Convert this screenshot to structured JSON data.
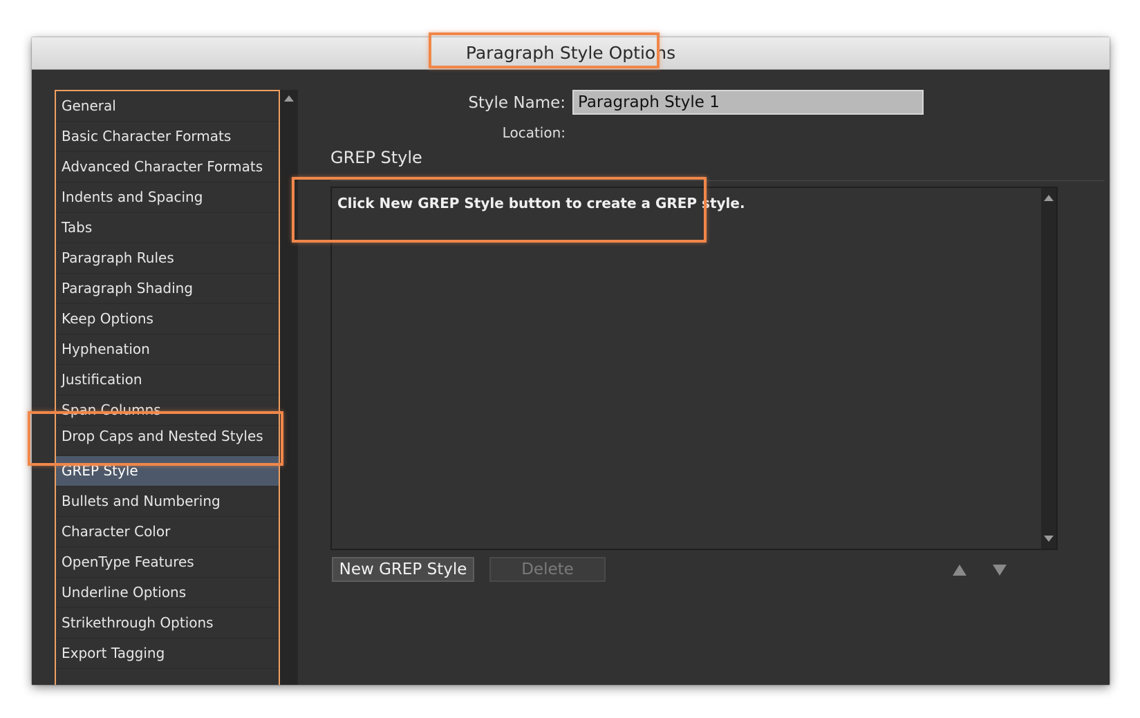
{
  "window": {
    "title": "Paragraph Style Options"
  },
  "sidebar": {
    "items": [
      {
        "label": "General"
      },
      {
        "label": "Basic Character Formats"
      },
      {
        "label": "Advanced Character Formats"
      },
      {
        "label": "Indents and Spacing"
      },
      {
        "label": "Tabs"
      },
      {
        "label": "Paragraph Rules"
      },
      {
        "label": "Paragraph Shading"
      },
      {
        "label": "Keep Options"
      },
      {
        "label": "Hyphenation"
      },
      {
        "label": "Justification"
      },
      {
        "label": "Span Columns"
      },
      {
        "label": "Drop Caps and Nested Styles"
      },
      {
        "label": "GREP Style"
      },
      {
        "label": "Bullets and Numbering"
      },
      {
        "label": "Character Color"
      },
      {
        "label": "OpenType Features"
      },
      {
        "label": "Underline Options"
      },
      {
        "label": "Strikethrough Options"
      },
      {
        "label": "Export Tagging"
      }
    ],
    "selected": "GREP Style"
  },
  "form": {
    "style_name_label": "Style Name:",
    "style_name_value": "Paragraph Style 1",
    "location_label": "Location:"
  },
  "section": {
    "heading": "GREP Style",
    "hint": "Click New GREP Style button to create a GREP style."
  },
  "buttons": {
    "new_grep": "New GREP Style",
    "delete": "Delete"
  },
  "icons": {
    "move_up": "triangle-up-icon",
    "move_down": "triangle-down-icon"
  },
  "colors": {
    "highlight": "#f0874a",
    "selected_row": "#4d596a",
    "background": "#323232"
  }
}
